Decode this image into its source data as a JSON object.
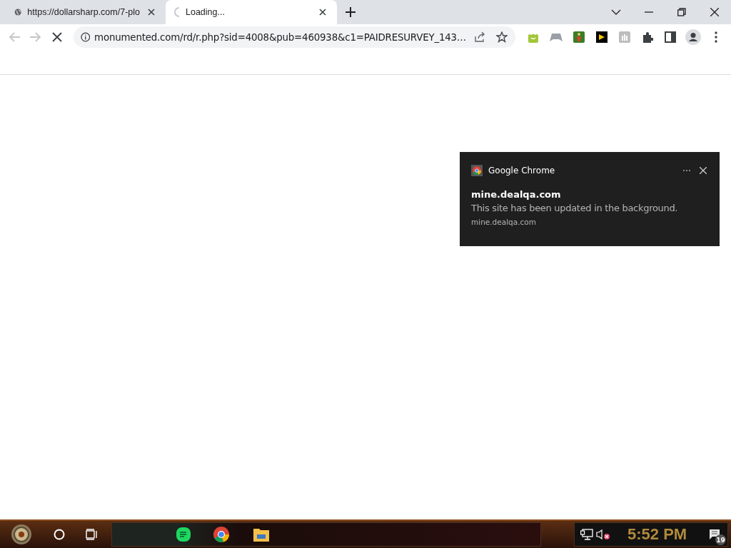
{
  "tabs": [
    {
      "kind": "globe",
      "title": "https://dollarsharp.com/7-plo",
      "selected": false
    },
    {
      "kind": "spinner",
      "title": "Loading...",
      "selected": true
    }
  ],
  "address_bar": {
    "url": "monumented.com/rd/r.php?sid=4008&pub=460938&c1=PAIDRESURVEY_143…"
  },
  "notification": {
    "app": "Google Chrome",
    "title": "mine.dealqa.com",
    "body": "This site has been updated in the background.",
    "source": "mine.dealqa.com"
  },
  "taskbar": {
    "clock": "5:52 PM",
    "notification_count": "19"
  }
}
